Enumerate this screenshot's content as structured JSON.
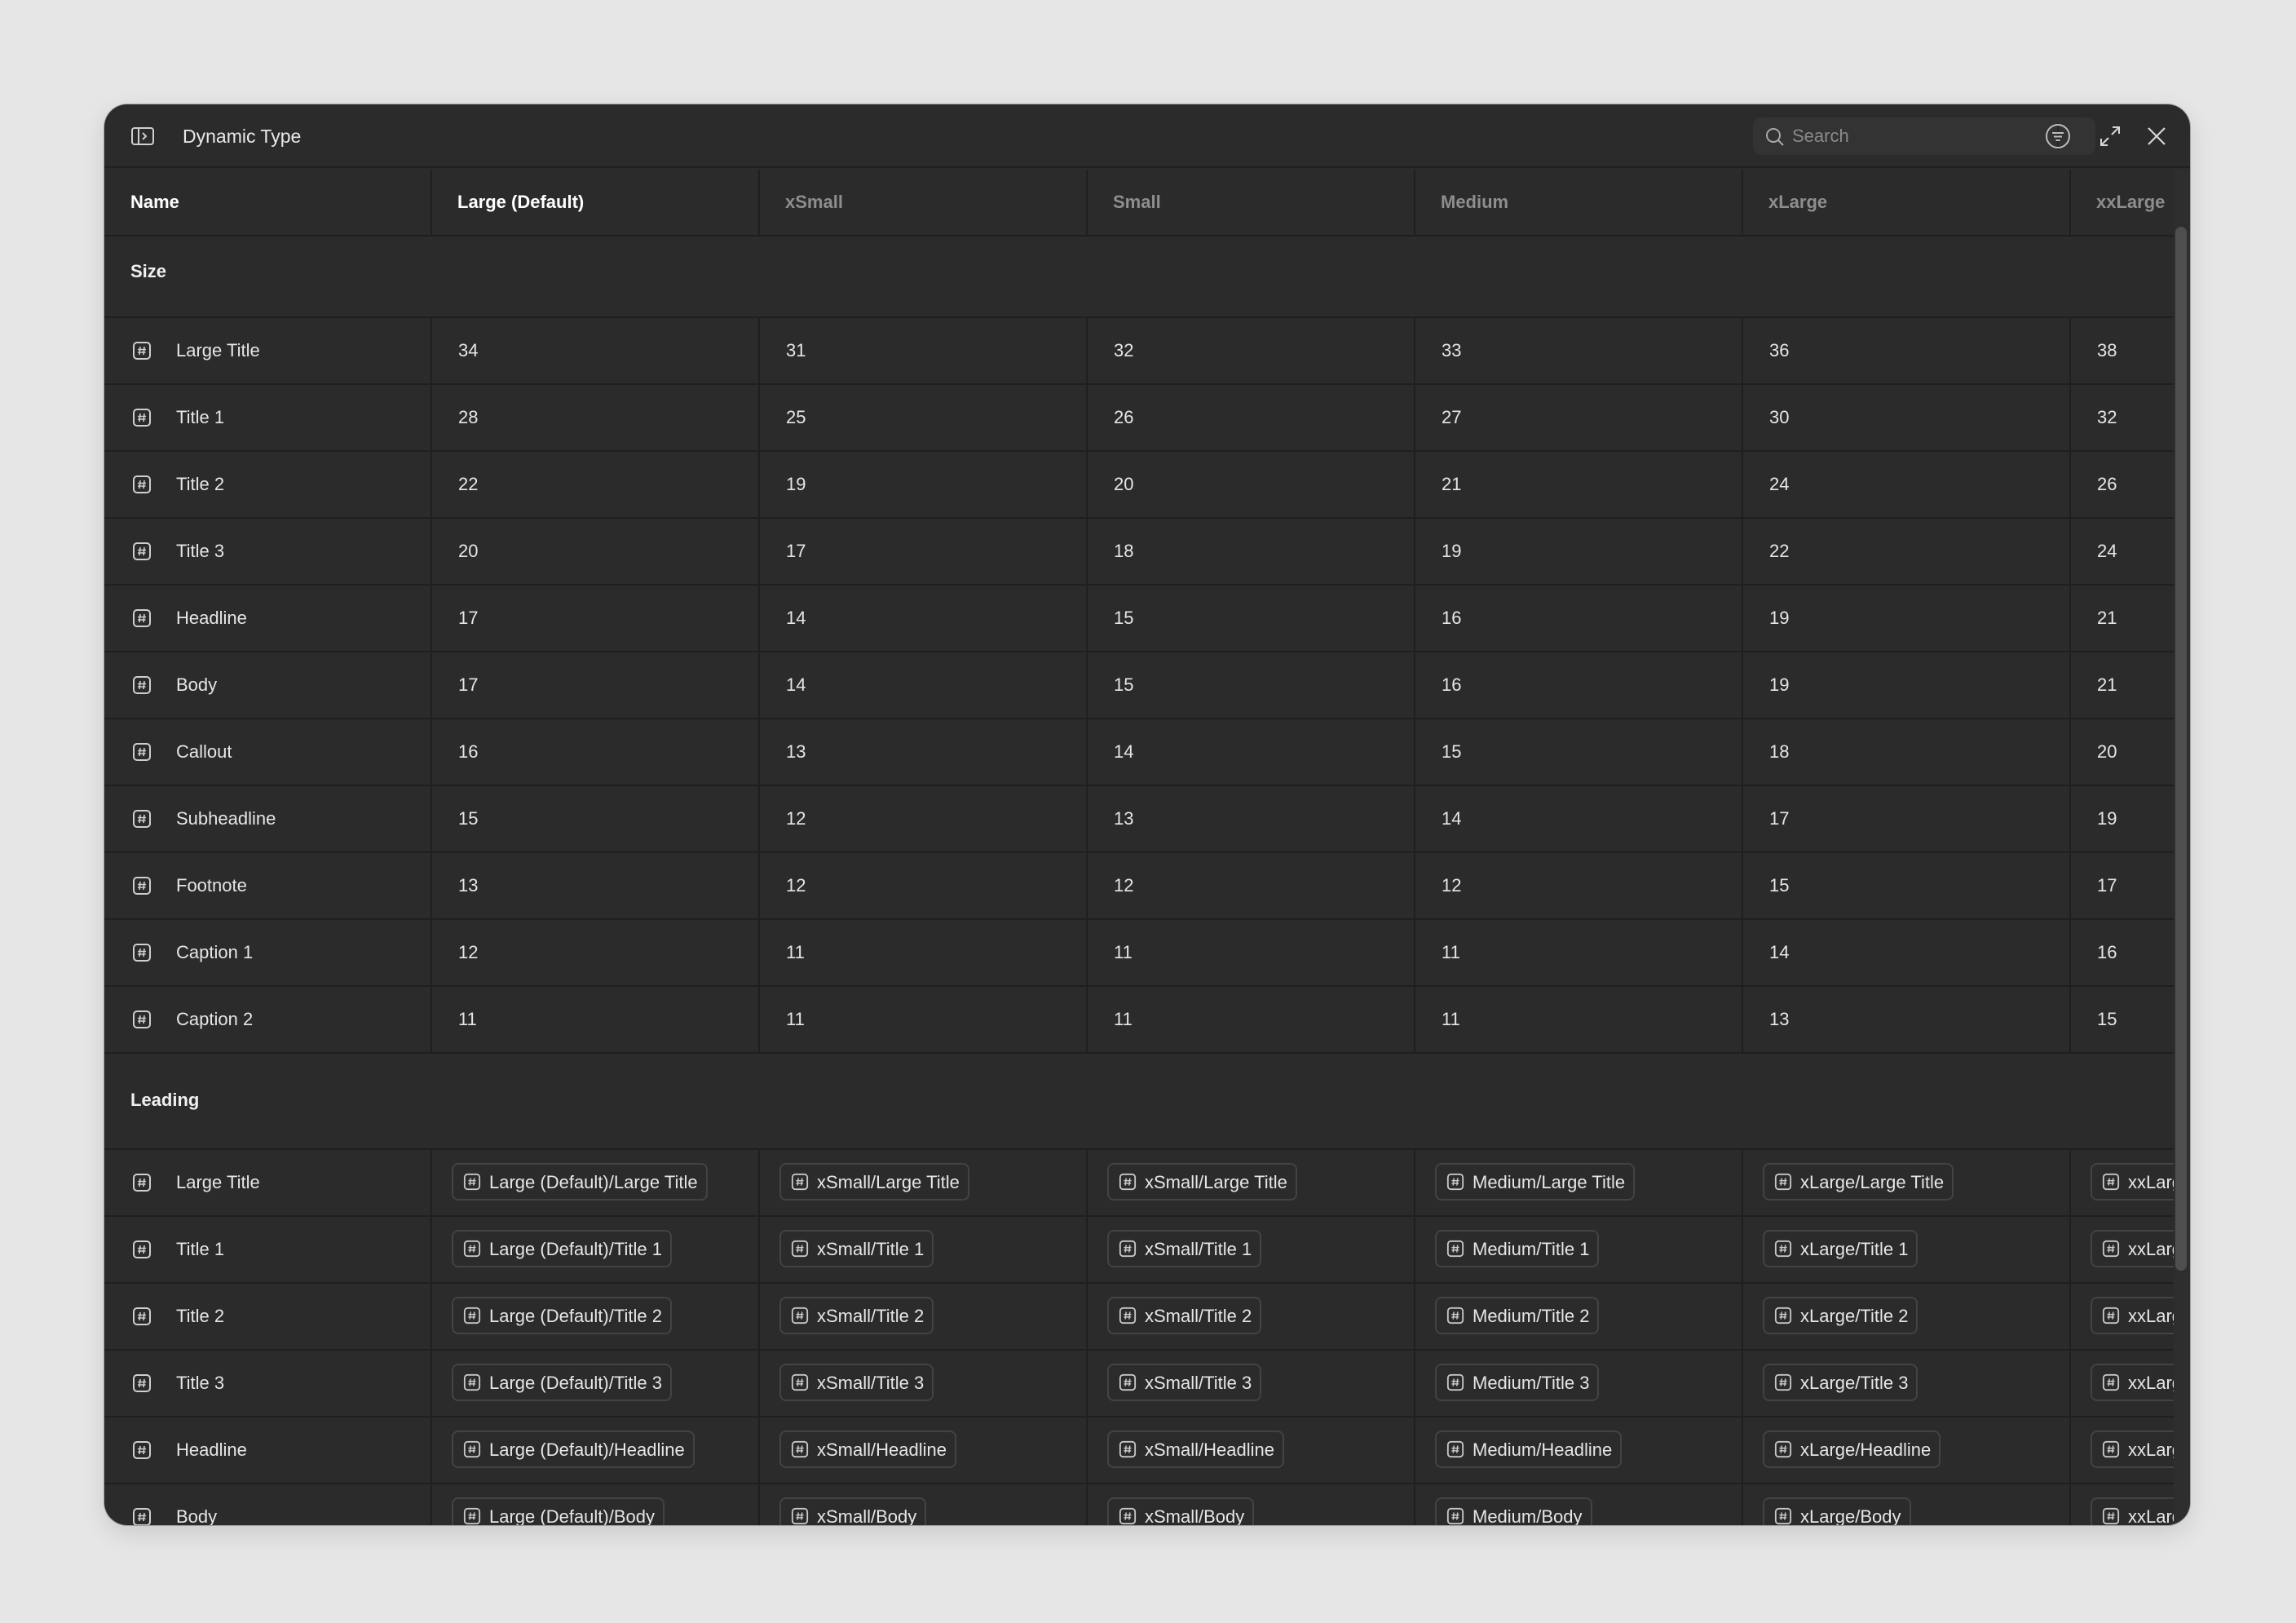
{
  "window": {
    "title": "Dynamic Type"
  },
  "search": {
    "placeholder": "Search",
    "value": ""
  },
  "columns": [
    "Name",
    "Large (Default)",
    "xSmall",
    "Small",
    "Medium",
    "xLarge",
    "xxLarge"
  ],
  "sections": {
    "size": {
      "title": "Size",
      "rows": [
        {
          "name": "Large Title",
          "values": [
            "34",
            "31",
            "32",
            "33",
            "36",
            "38"
          ]
        },
        {
          "name": "Title 1",
          "values": [
            "28",
            "25",
            "26",
            "27",
            "30",
            "32"
          ]
        },
        {
          "name": "Title 2",
          "values": [
            "22",
            "19",
            "20",
            "21",
            "24",
            "26"
          ]
        },
        {
          "name": "Title 3",
          "values": [
            "20",
            "17",
            "18",
            "19",
            "22",
            "24"
          ]
        },
        {
          "name": "Headline",
          "values": [
            "17",
            "14",
            "15",
            "16",
            "19",
            "21"
          ]
        },
        {
          "name": "Body",
          "values": [
            "17",
            "14",
            "15",
            "16",
            "19",
            "21"
          ]
        },
        {
          "name": "Callout",
          "values": [
            "16",
            "13",
            "14",
            "15",
            "18",
            "20"
          ]
        },
        {
          "name": "Subheadline",
          "values": [
            "15",
            "12",
            "13",
            "14",
            "17",
            "19"
          ]
        },
        {
          "name": "Footnote",
          "values": [
            "13",
            "12",
            "12",
            "12",
            "15",
            "17"
          ]
        },
        {
          "name": "Caption 1",
          "values": [
            "12",
            "11",
            "11",
            "11",
            "14",
            "16"
          ]
        },
        {
          "name": "Caption 2",
          "values": [
            "11",
            "11",
            "11",
            "11",
            "13",
            "15"
          ]
        }
      ]
    },
    "leading": {
      "title": "Leading",
      "rows": [
        {
          "name": "Large Title",
          "values": [
            "Large (Default)/Large Title",
            "xSmall/Large Title",
            "xSmall/Large Title",
            "Medium/Large Title",
            "xLarge/Large Title",
            "xxLarg"
          ]
        },
        {
          "name": "Title 1",
          "values": [
            "Large (Default)/Title 1",
            "xSmall/Title 1",
            "xSmall/Title 1",
            "Medium/Title 1",
            "xLarge/Title 1",
            "xxLarg"
          ]
        },
        {
          "name": "Title 2",
          "values": [
            "Large (Default)/Title 2",
            "xSmall/Title 2",
            "xSmall/Title 2",
            "Medium/Title 2",
            "xLarge/Title 2",
            "xxLarg"
          ]
        },
        {
          "name": "Title 3",
          "values": [
            "Large (Default)/Title 3",
            "xSmall/Title 3",
            "xSmall/Title 3",
            "Medium/Title 3",
            "xLarge/Title 3",
            "xxLarg"
          ]
        },
        {
          "name": "Headline",
          "values": [
            "Large (Default)/Headline",
            "xSmall/Headline",
            "xSmall/Headline",
            "Medium/Headline",
            "xLarge/Headline",
            "xxLarg"
          ]
        },
        {
          "name": "Body",
          "values": [
            "Large (Default)/Body",
            "xSmall/Body",
            "xSmall/Body",
            "Medium/Body",
            "xLarge/Body",
            "xxLarg"
          ]
        }
      ]
    }
  }
}
